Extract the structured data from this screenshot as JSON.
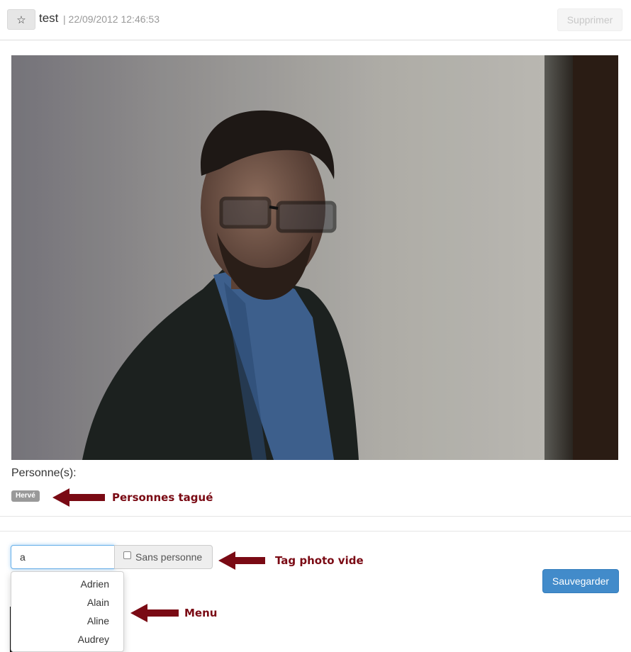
{
  "header": {
    "favorite_icon": "star-icon",
    "favorite_glyph": "☆",
    "title": "test",
    "separator_date": "| 22/09/2012 12:46:53",
    "delete_label": "Supprimer"
  },
  "photo": {
    "description_hint": "portrait"
  },
  "persons": {
    "label": "Personne(s):",
    "tags": [
      "Hervé"
    ]
  },
  "tag_form": {
    "input_value": "a",
    "no_person_label": "Sans personne",
    "no_person_checked": false,
    "save_label": "Sauvegarder"
  },
  "menu": {
    "items": [
      "Adrien",
      "Alain",
      "Aline",
      "Audrey"
    ]
  },
  "annotations": {
    "tagged": "Personnes tagué",
    "empty_tag": "Tag photo vide",
    "menu": "Menu",
    "color": "#7a0a14"
  },
  "colors": {
    "primary": "#428bca",
    "annotation": "#7a0a14"
  }
}
